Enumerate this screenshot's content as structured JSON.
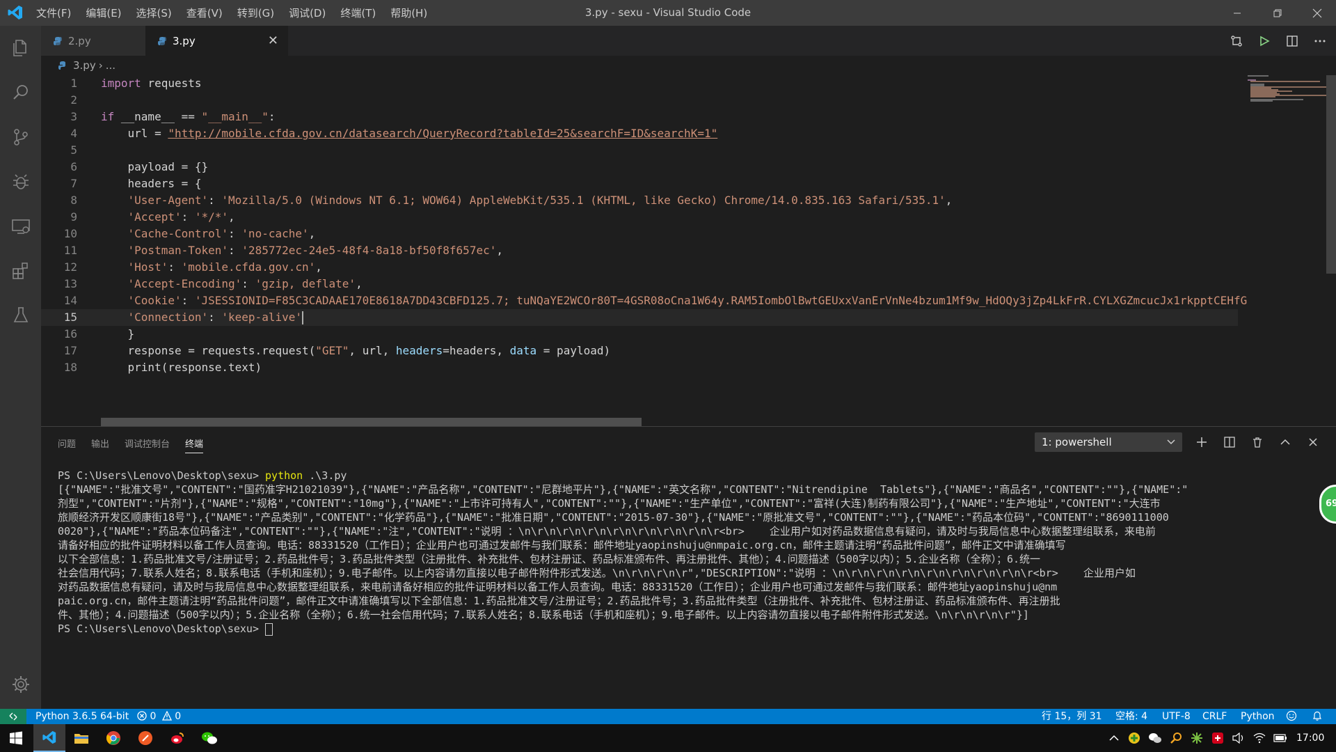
{
  "window": {
    "title": "3.py - sexu - Visual Studio Code",
    "menu": [
      "文件(F)",
      "编辑(E)",
      "选择(S)",
      "查看(V)",
      "转到(G)",
      "调试(D)",
      "终端(T)",
      "帮助(H)"
    ]
  },
  "activity_bar": [
    "explorer-icon",
    "search-icon",
    "source-control-icon",
    "debug-icon",
    "remote-explorer-icon",
    "extensions-icon",
    "test-icon",
    "settings-gear-icon"
  ],
  "tabs": [
    {
      "label": "2.py",
      "active": false
    },
    {
      "label": "3.py",
      "active": true,
      "close": "✕"
    }
  ],
  "breadcrumb": {
    "file": "3.py",
    "sep": "›",
    "rest": "..."
  },
  "editor": {
    "line_numbers": [
      "1",
      "2",
      "3",
      "4",
      "5",
      "6",
      "7",
      "8",
      "9",
      "10",
      "11",
      "12",
      "13",
      "14",
      "15",
      "16",
      "17",
      "18"
    ],
    "cursor_line": 15,
    "code": {
      "l1_kw": "import",
      "l1_rest": " requests",
      "l3_kw": "if",
      "l3_a": " __name__ == ",
      "l3_str": "\"__main__\"",
      "l3_b": ":",
      "l4_a": "    url = ",
      "l4_url": "\"http://mobile.cfda.gov.cn/datasearch/QueryRecord?tableId=25&searchF=ID&searchK=1\"",
      "l6": "    payload = {}",
      "l7": "    headers = {",
      "l8_k": "    'User-Agent'",
      "l8_v": "'Mozilla/5.0 (Windows NT 6.1; WOW64) AppleWebKit/535.1 (KHTML, like Gecko) Chrome/14.0.835.163 Safari/535.1'",
      "l9_k": "    'Accept'",
      "l9_v": "'*/*'",
      "l10_k": "    'Cache-Control'",
      "l10_v": "'no-cache'",
      "l11_k": "    'Postman-Token'",
      "l11_v": "'285772ec-24e5-48f4-8a18-bf50f8f657ec'",
      "l12_k": "    'Host'",
      "l12_v": "'mobile.cfda.gov.cn'",
      "l13_k": "    'Accept-Encoding'",
      "l13_v": "'gzip, deflate'",
      "l14_k": "    'Cookie'",
      "l14_v": "'JSESSIONID=F85C3CADAAE170E8618A7DD43CBFD125.7; tuNQaYE2WCOr80T=4GSR08oCna1W64y.RAM5IombOlBwtGEUxxVanErVnNe4bzum1Mf9w_HdOQy3jZp4LkFrR.CYLXGZmcucJx1rkpptCEHfG",
      "l15_k": "    'Connection'",
      "l15_v": "'keep-alive'",
      "l16": "    }",
      "l17_a": "    response = requests.request(",
      "l17_str": "\"GET\"",
      "l17_b": ", url, ",
      "l17_p1": "headers",
      "l17_c": "=headers, ",
      "l17_p2": "data",
      "l17_d": " = payload)",
      "l18": "    print(response.text)"
    }
  },
  "panel": {
    "tabs": [
      "问题",
      "输出",
      "调试控制台",
      "终端"
    ],
    "active_tab": "终端",
    "terminal_select": "1: powershell",
    "terminal": {
      "prompt": "PS C:\\Users\\Lenovo\\Desktop\\sexu> ",
      "command": "python",
      "command_arg": " .\\3.py",
      "output": [
        "[{\"NAME\":\"批准文号\",\"CONTENT\":\"国药准字H21021039\"},{\"NAME\":\"产品名称\",\"CONTENT\":\"尼群地平片\"},{\"NAME\":\"英文名称\",\"CONTENT\":\"Nitrendipine  Tablets\"},{\"NAME\":\"商品名\",\"CONTENT\":\"\"},{\"NAME\":\"",
        "剂型\",\"CONTENT\":\"片剂\"},{\"NAME\":\"规格\",\"CONTENT\":\"10mg\"},{\"NAME\":\"上市许可持有人\",\"CONTENT\":\"\"},{\"NAME\":\"生产单位\",\"CONTENT\":\"富祥(大连)制药有限公司\"},{\"NAME\":\"生产地址\",\"CONTENT\":\"大连市",
        "旅顺经济开发区顺康街18号\"},{\"NAME\":\"产品类别\",\"CONTENT\":\"化学药品\"},{\"NAME\":\"批准日期\",\"CONTENT\":\"2015-07-30\"},{\"NAME\":\"原批准文号\",\"CONTENT\":\"\"},{\"NAME\":\"药品本位码\",\"CONTENT\":\"8690111000",
        "0020\"},{\"NAME\":\"药品本位码备注\",\"CONTENT\":\"\"},{\"NAME\":\"注\",\"CONTENT\":\"说明 ：\\n\\r\\n\\r\\n\\r\\n\\r\\n\\r\\n\\r\\n\\r\\n\\r<br>    企业用户如对药品数据信息有疑问，请及时与我局信息中心数据整理组联系，来电前",
        "请备好相应的批件证明材料以备工作人员查询。电话：88331520（工作日）；企业用户也可通过发邮件与我们联系：邮件地址yaopinshuju@nmpaic.org.cn，邮件主题请注明“药品批件问题”，邮件正文中请准确填写",
        "以下全部信息：1.药品批准文号/注册证号；2.药品批件号；3.药品批件类型（注册批件、补充批件、包材注册证、药品标准颁布件、再注册批件、其他）；4.问题描述（500字以内）；5.企业名称（全称）；6.统一",
        "社会信用代码；7.联系人姓名；8.联系电话（手机和座机）；9.电子邮件。以上内容请勿直接以电子邮件附件形式发送。\\n\\r\\n\\r\\n\\r\",\"DESCRIPTION\":\"说明 ：\\n\\r\\n\\r\\n\\r\\n\\r\\n\\r\\n\\r\\n\\r\\n\\r<br>    企业用户如",
        "对药品数据信息有疑问，请及时与我局信息中心数据整理组联系，来电前请备好相应的批件证明材料以备工作人员查询。电话：88331520（工作日）；企业用户也可通过发邮件与我们联系：邮件地址yaopinshuju@nm",
        "paic.org.cn，邮件主题请注明“药品批件问题”，邮件正文中请准确填写以下全部信息：1.药品批准文号/注册证号；2.药品批件号；3.药品批件类型（注册批件、补充批件、包材注册证、药品标准颁布件、再注册批",
        "件、其他）；4.问题描述（500字以内）；5.企业名称（全称）；6.统一社会信用代码；7.联系人姓名；8.联系电话（手机和座机）；9.电子邮件。以上内容请勿直接以电子邮件附件形式发送。\\n\\r\\n\\r\\n\\r\"}]"
      ],
      "final_prompt": "PS C:\\Users\\Lenovo\\Desktop\\sexu> "
    }
  },
  "statusbar": {
    "interpreter": "Python 3.6.5 64-bit",
    "errors": "0",
    "warnings": "0",
    "position": "行 15，列 31",
    "spaces": "空格: 4",
    "encoding": "UTF-8",
    "eol": "CRLF",
    "language": "Python"
  },
  "floating_badge": "69",
  "taskbar": {
    "apps": [
      "windows-start-icon",
      "vscode-icon",
      "file-explorer-icon",
      "chrome-icon",
      "postman-icon",
      "weibo-icon",
      "wechat-icon"
    ],
    "tray": [
      "tray-chevron-icon",
      "tray-app-icon",
      "wechat-tray-icon",
      "search-tray-icon",
      "tray-app-icon-2",
      "antivirus-tray-icon",
      "volume-icon",
      "wifi-icon",
      "battery-icon"
    ],
    "clock": "17:00"
  },
  "colors": {
    "accent": "#007acc",
    "titlebar": "#3c3c3c",
    "activity_bar": "#333333",
    "editor_bg": "#1e1e1e",
    "remote": "#16825d"
  }
}
